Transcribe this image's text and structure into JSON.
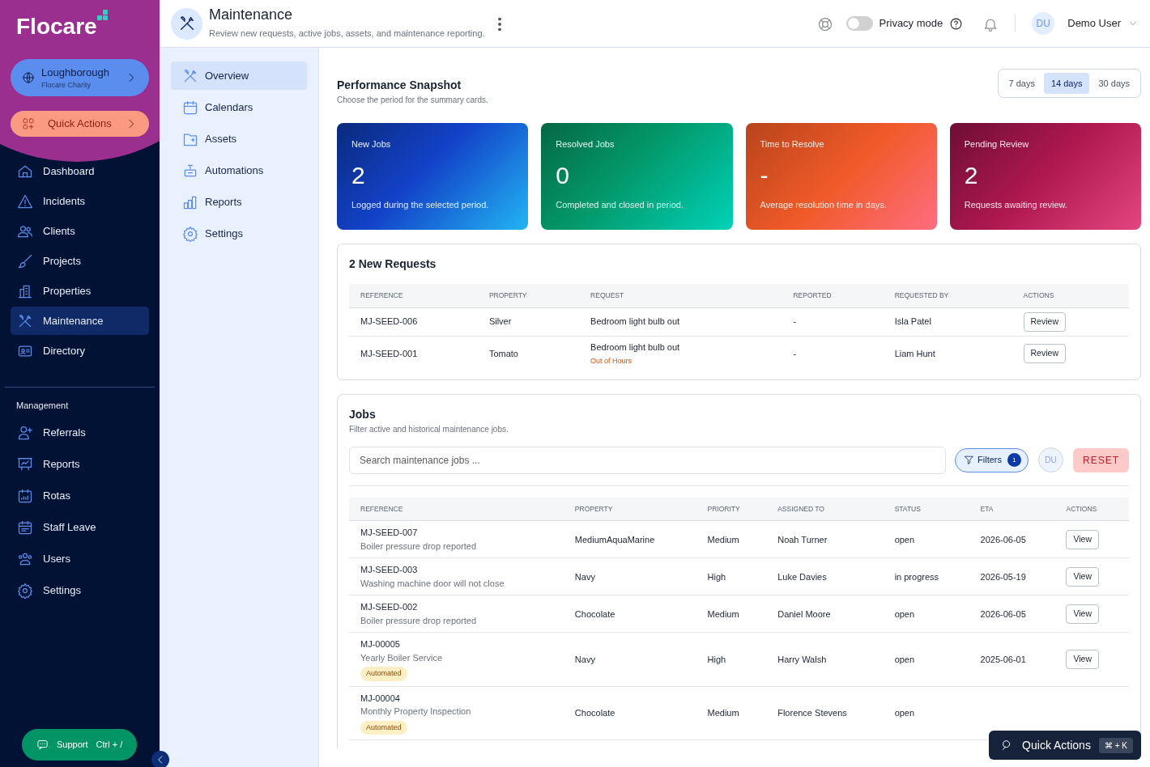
{
  "brand": {
    "name": "Flocare"
  },
  "org": {
    "name": "Loughborough",
    "subtitle": "Flocare Charity"
  },
  "quick_actions_button": {
    "label": "Quick Actions"
  },
  "nav": [
    {
      "label": "Dashboard",
      "selected": false
    },
    {
      "label": "Incidents",
      "selected": false
    },
    {
      "label": "Clients",
      "selected": false
    },
    {
      "label": "Projects",
      "selected": false
    },
    {
      "label": "Properties",
      "selected": false
    },
    {
      "label": "Maintenance",
      "selected": true
    },
    {
      "label": "Directory",
      "selected": false
    }
  ],
  "management": {
    "heading": "Management",
    "items": [
      {
        "label": "Referrals",
        "selected": false
      },
      {
        "label": "Reports",
        "selected": false
      },
      {
        "label": "Rotas",
        "selected": false
      },
      {
        "label": "Staff Leave",
        "selected": false
      },
      {
        "label": "Users",
        "selected": false
      },
      {
        "label": "Settings",
        "selected": false
      }
    ]
  },
  "support": {
    "label": "Support",
    "shortcut": "Ctrl + /"
  },
  "header": {
    "title": "Maintenance",
    "subtitle": "Review new requests, active jobs, assets, and maintenance reporting.",
    "privacy": {
      "label": "Privacy mode",
      "on": false
    },
    "user": {
      "initials": "DU",
      "name": "Demo User"
    }
  },
  "subnav": [
    {
      "label": "Overview",
      "selected": true
    },
    {
      "label": "Calendars",
      "selected": false
    },
    {
      "label": "Assets",
      "selected": false
    },
    {
      "label": "Automations",
      "selected": false
    },
    {
      "label": "Reports",
      "selected": false
    },
    {
      "label": "Settings",
      "selected": false
    }
  ],
  "snapshot": {
    "title": "Performance Snapshot",
    "subtitle": "Choose the period for the summary cards.",
    "periods": [
      {
        "label": "7 days",
        "selected": false
      },
      {
        "label": "14 days",
        "selected": true
      },
      {
        "label": "30 days",
        "selected": false
      }
    ]
  },
  "stat_cards": [
    {
      "title": "New Jobs",
      "value": "2",
      "caption": "Logged during the selected period."
    },
    {
      "title": "Resolved Jobs",
      "value": "0",
      "caption": "Completed and closed in period."
    },
    {
      "title": "Time to Resolve",
      "value": "-",
      "caption": "Average resolution time in days."
    },
    {
      "title": "Pending Review",
      "value": "2",
      "caption": "Requests awaiting review."
    }
  ],
  "requests": {
    "title": "2 New Requests",
    "columns": [
      "REFERENCE",
      "PROPERTY",
      "REQUEST",
      "REPORTED",
      "REQUESTED BY",
      "ACTIONS"
    ],
    "rows": [
      {
        "reference": "MJ-SEED-006",
        "property": "Silver",
        "request": "Bedroom light bulb out",
        "reported": "-",
        "requested_by": "Isla Patel",
        "action": "Review"
      },
      {
        "reference": "MJ-SEED-001",
        "property": "Tomato",
        "request": "Bedroom light bulb out",
        "tag": "Out of Hours",
        "reported": "-",
        "requested_by": "Liam Hunt",
        "action": "Review"
      }
    ]
  },
  "jobs": {
    "title": "Jobs",
    "subtitle": "Filter active and historical maintenance jobs.",
    "search": {
      "placeholder": "Search maintenance jobs ..."
    },
    "filters": {
      "label": "Filters",
      "count": "1"
    },
    "avatar": "DU",
    "reset": "RESET",
    "columns": [
      "REFERENCE",
      "PROPERTY",
      "PRIORITY",
      "ASSIGNED TO",
      "STATUS",
      "ETA",
      "ACTIONS"
    ],
    "rows": [
      {
        "reference": "MJ-SEED-007",
        "description": "Boiler pressure drop reported",
        "property": "MediumAquaMarine",
        "priority": "Medium",
        "assigned_to": "Noah Turner",
        "status": "open",
        "eta": "2026-06-05",
        "action": "View"
      },
      {
        "reference": "MJ-SEED-003",
        "description": "Washing machine door will not close",
        "property": "Navy",
        "priority": "High",
        "assigned_to": "Luke Davies",
        "status": "in progress",
        "eta": "2026-05-19",
        "action": "View"
      },
      {
        "reference": "MJ-SEED-002",
        "description": "Boiler pressure drop reported",
        "property": "Chocolate",
        "priority": "Medium",
        "assigned_to": "Daniel Moore",
        "status": "open",
        "eta": "2026-06-05",
        "action": "View"
      },
      {
        "reference": "MJ-00005",
        "description": "Yearly Boiler Service",
        "badge": "Automated",
        "property": "Navy",
        "priority": "High",
        "assigned_to": "Harry Walsh",
        "status": "open",
        "eta": "2025-06-01",
        "action": "View"
      },
      {
        "reference": "MJ-00004",
        "description": "Monthly Property Inspection",
        "badge": "Automated",
        "property": "Chocolate",
        "priority": "Medium",
        "assigned_to": "Florence Stevens",
        "status": "open"
      }
    ]
  },
  "quick_actions_popup": {
    "label": "Quick Actions",
    "shortcut": "⌘ + K"
  }
}
